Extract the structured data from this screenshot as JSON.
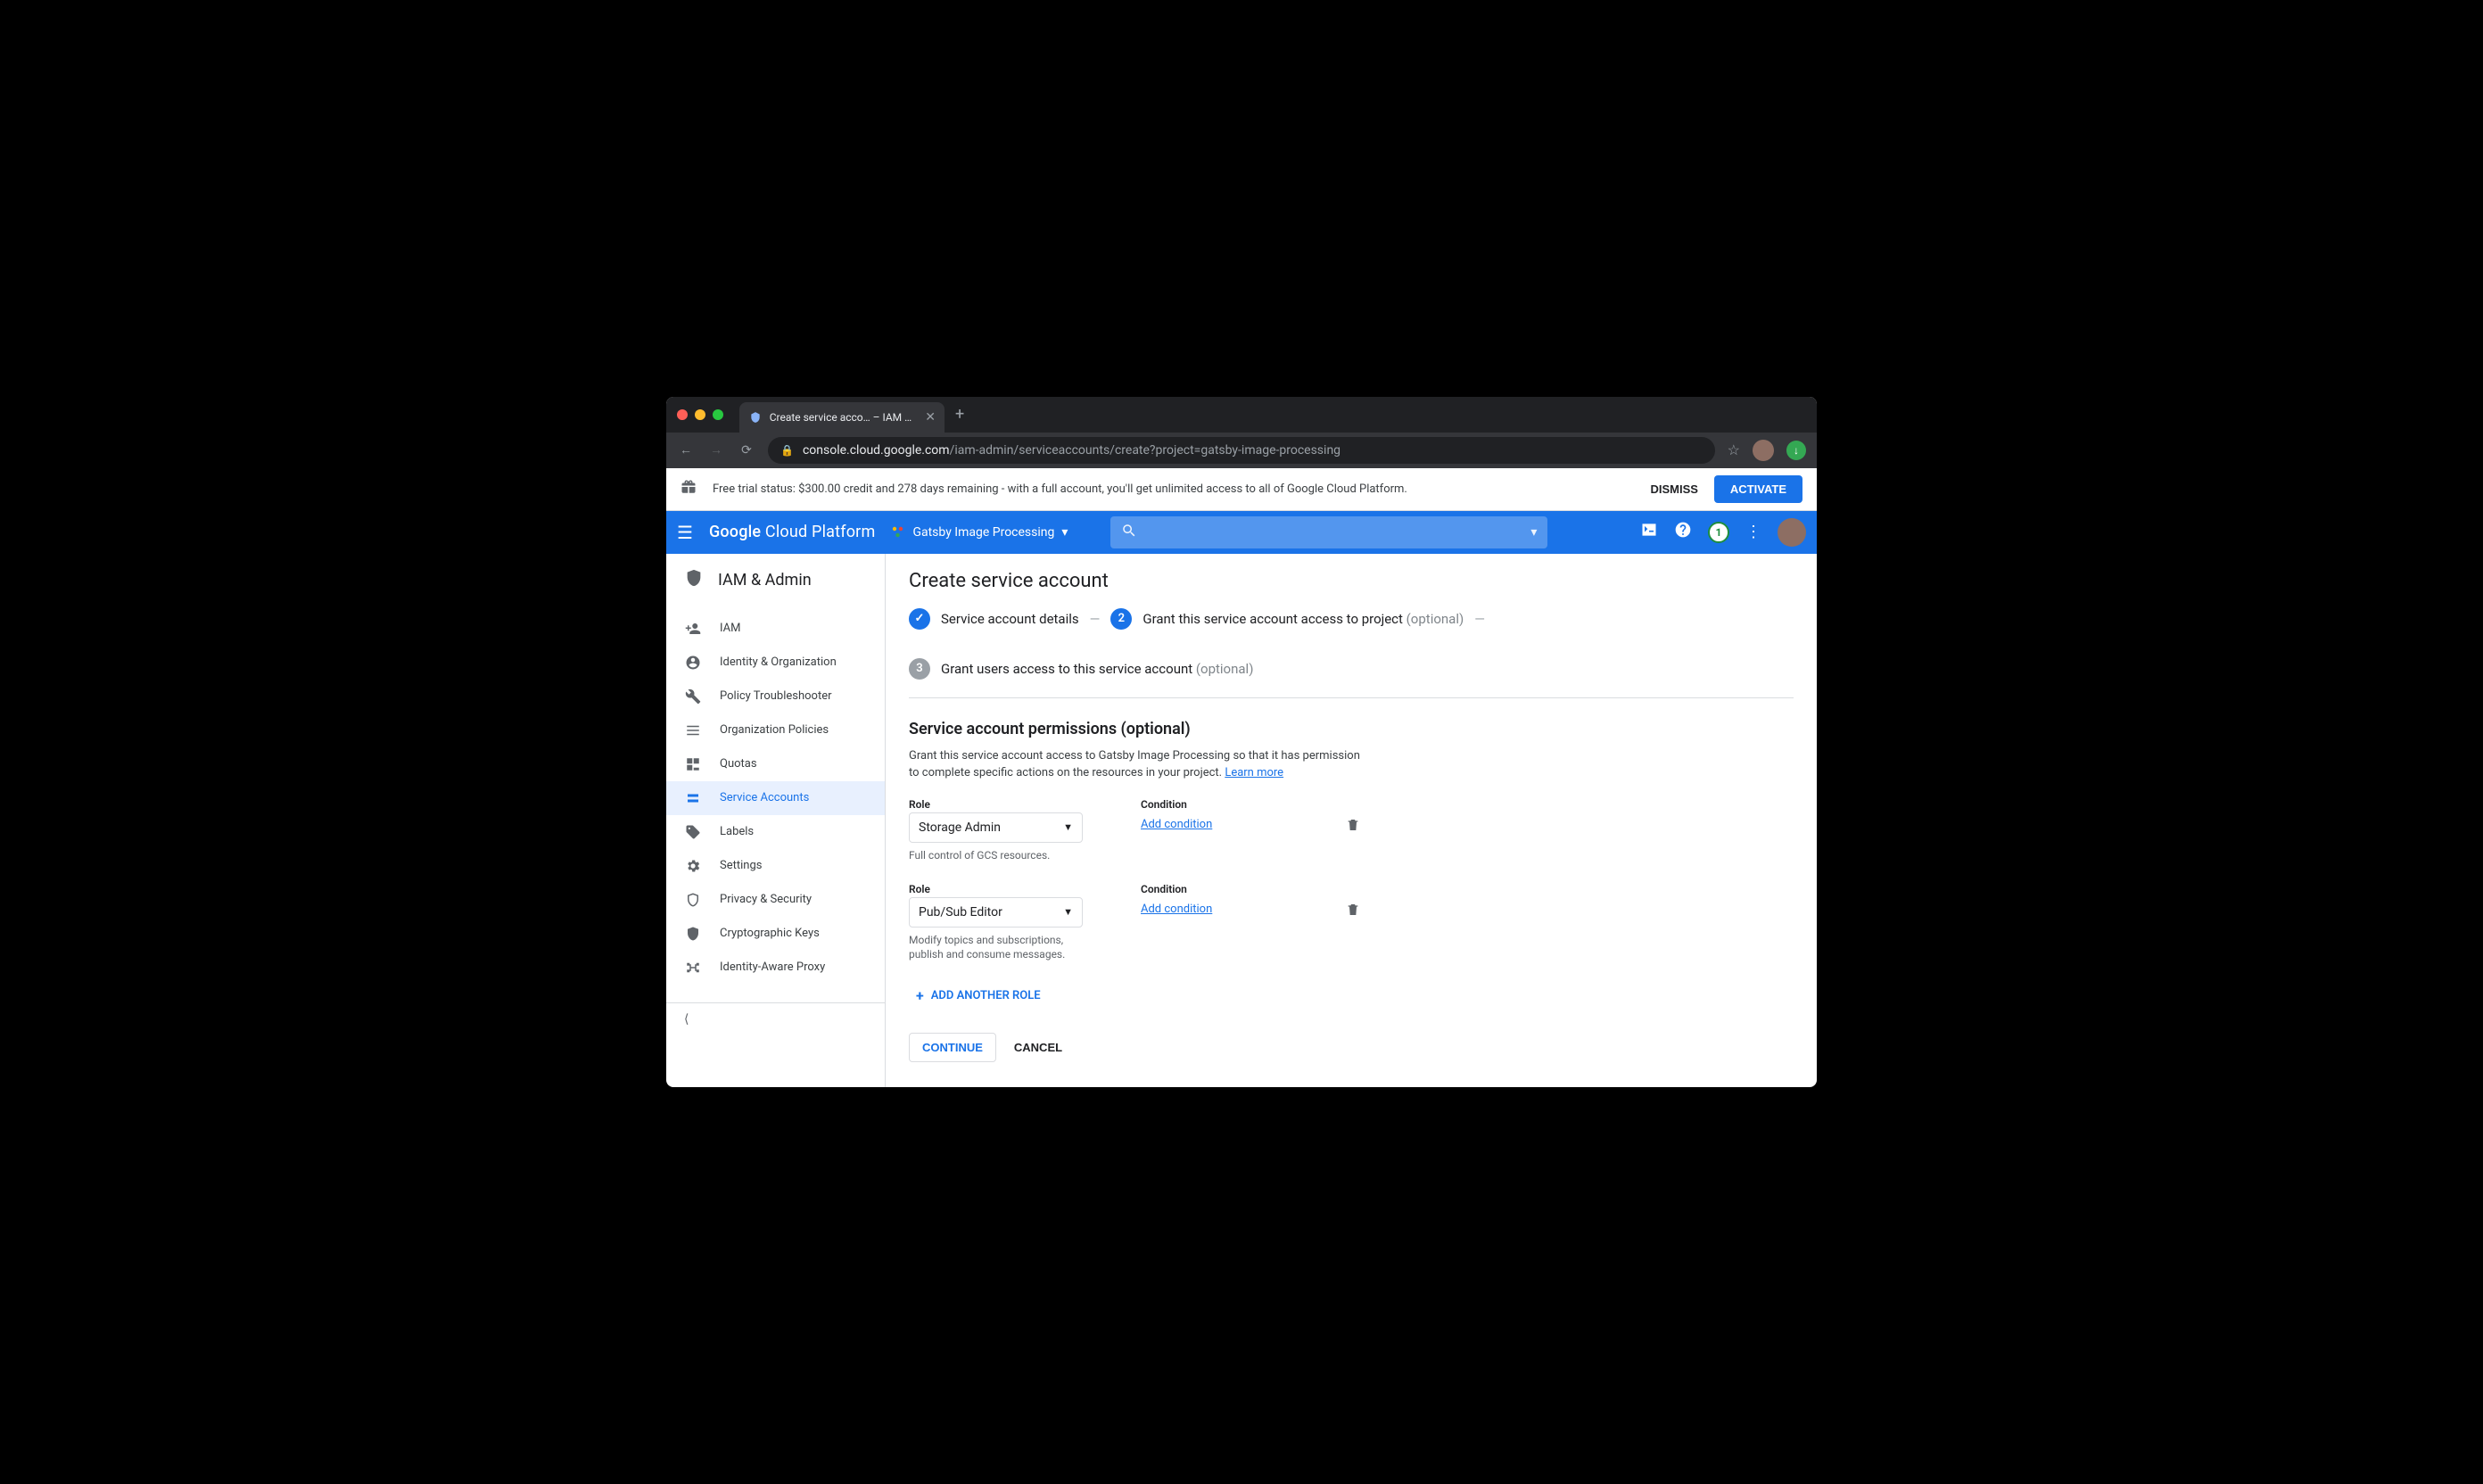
{
  "browser": {
    "tab_title": "Create service acco… – IAM & …",
    "url_host": "console.cloud.google.com",
    "url_path": "/iam-admin/serviceaccounts/create?project=gatsby-image-processing"
  },
  "trial": {
    "text": "Free trial status: $300.00 credit and 278 days remaining - with a full account, you'll get unlimited access to all of Google Cloud Platform.",
    "dismiss": "DISMISS",
    "activate": "ACTIVATE"
  },
  "header": {
    "brand_prefix": "Google",
    "brand_rest": " Cloud Platform",
    "project": "Gatsby Image Processing",
    "notifications": "1"
  },
  "sidebar": {
    "title": "IAM & Admin",
    "items": [
      {
        "label": "IAM"
      },
      {
        "label": "Identity & Organization"
      },
      {
        "label": "Policy Troubleshooter"
      },
      {
        "label": "Organization Policies"
      },
      {
        "label": "Quotas"
      },
      {
        "label": "Service Accounts"
      },
      {
        "label": "Labels"
      },
      {
        "label": "Settings"
      },
      {
        "label": "Privacy & Security"
      },
      {
        "label": "Cryptographic Keys"
      },
      {
        "label": "Identity-Aware Proxy"
      }
    ]
  },
  "main": {
    "page_title": "Create service account",
    "steps": {
      "s1": "Service account details",
      "s2": "Grant this service account access to project",
      "s3": "Grant users access to this service account",
      "optional": "(optional)"
    },
    "section_title": "Service account permissions (optional)",
    "section_desc": "Grant this service account access to Gatsby Image Processing so that it has permission to complete specific actions on the resources in your project. ",
    "learn_more": "Learn more",
    "role_label": "Role",
    "condition_label": "Condition",
    "add_condition": "Add condition",
    "roles": [
      {
        "value": "Storage Admin",
        "desc": "Full control of GCS resources."
      },
      {
        "value": "Pub/Sub Editor",
        "desc": "Modify topics and subscriptions, publish and consume messages."
      }
    ],
    "add_role": "ADD ANOTHER ROLE",
    "continue": "CONTINUE",
    "cancel": "CANCEL"
  }
}
